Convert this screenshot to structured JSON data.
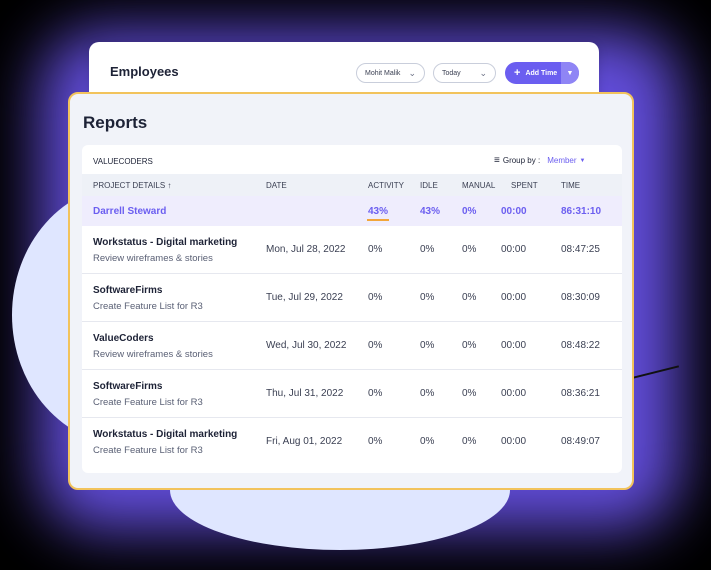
{
  "employees": {
    "title": "Employees",
    "member_select": "Mohit Malik",
    "date_select": "Today",
    "add_button": "Add Time"
  },
  "reports": {
    "title": "Reports",
    "organization": "VALUECODERS",
    "group_by_label": "Group by :",
    "group_by_value": "Member",
    "columns": [
      "PROJECT DETAILS ↑",
      "DATE",
      "ACTIVITY",
      "IDLE",
      "MANUAL",
      "SPENT",
      "TIME"
    ],
    "member": {
      "name": "Darrell Steward",
      "activity": "43%",
      "idle": "43%",
      "manual": "0%",
      "spent": "00:00",
      "time": "86:31:10"
    },
    "rows": [
      {
        "project": "Workstatus - Digital marketing",
        "task": "Review wireframes & stories",
        "date": "Mon, Jul 28, 2022",
        "activity": "0%",
        "idle": "0%",
        "manual": "0%",
        "spent": "00:00",
        "time": "08:47:25"
      },
      {
        "project": "SoftwareFirms",
        "task": "Create Feature List for R3",
        "date": "Tue, Jul 29, 2022",
        "activity": "0%",
        "idle": "0%",
        "manual": "0%",
        "spent": "00:00",
        "time": "08:30:09"
      },
      {
        "project": "ValueCoders",
        "task": "Review wireframes & stories",
        "date": "Wed, Jul 30, 2022",
        "activity": "0%",
        "idle": "0%",
        "manual": "0%",
        "spent": "00:00",
        "time": "08:48:22"
      },
      {
        "project": "SoftwareFirms",
        "task": "Create Feature List for R3",
        "date": "Thu, Jul 31, 2022",
        "activity": "0%",
        "idle": "0%",
        "manual": "0%",
        "spent": "00:00",
        "time": "08:36:21"
      },
      {
        "project": "Workstatus - Digital marketing",
        "task": "Create Feature List for R3",
        "date": "Fri, Aug 01, 2022",
        "activity": "0%",
        "idle": "0%",
        "manual": "0%",
        "spent": "00:00",
        "time": "08:49:07"
      }
    ]
  },
  "colors": {
    "accent": "#6b5ef0",
    "highlight": "#f2c35c",
    "activity_underline": "#f2a63a"
  }
}
